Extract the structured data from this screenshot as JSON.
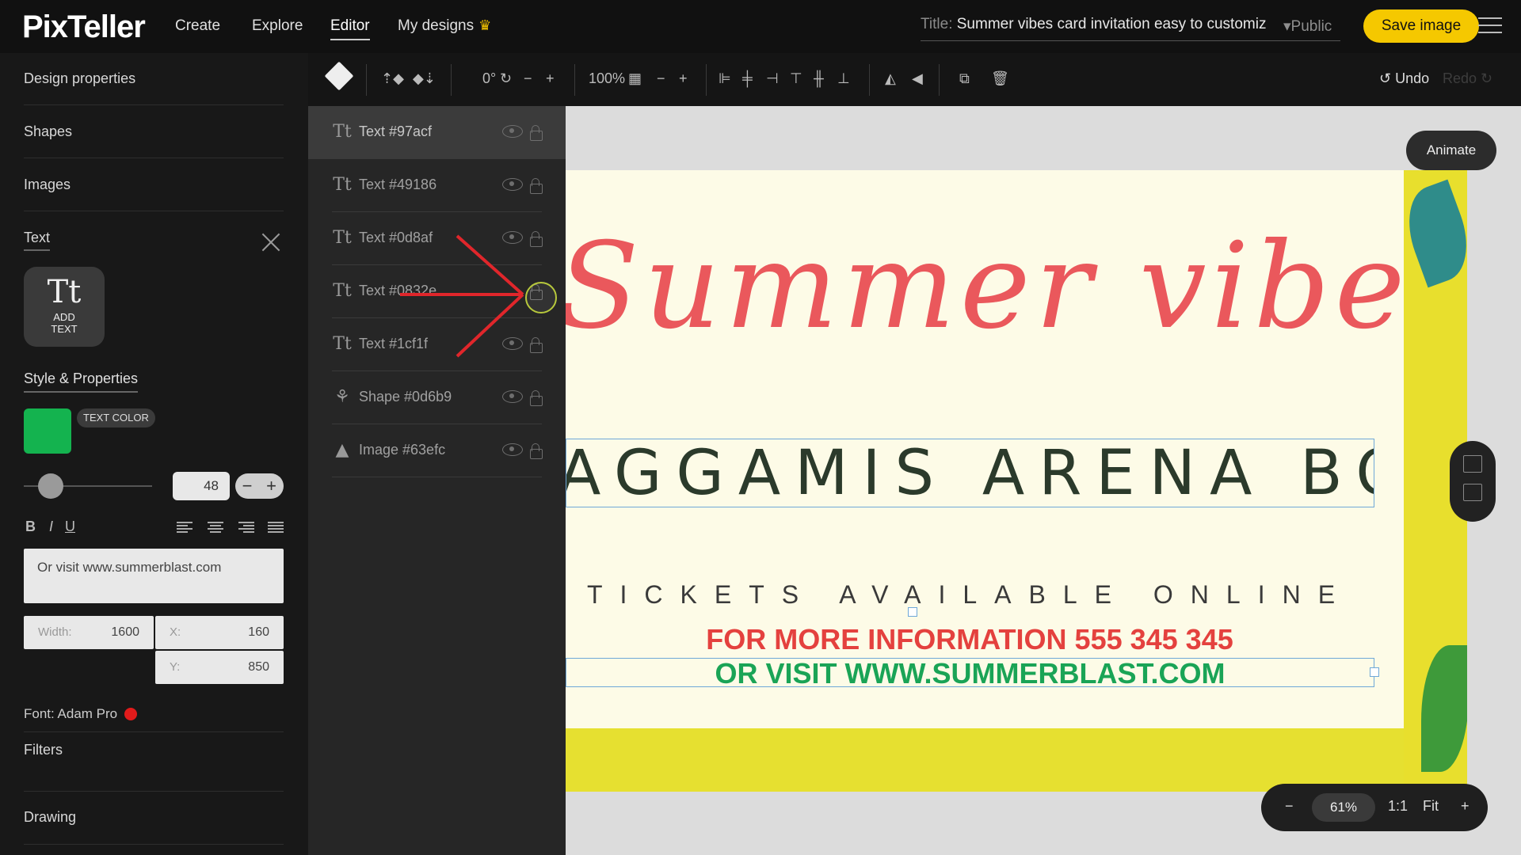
{
  "app": {
    "logo": "PixTeller"
  },
  "nav": {
    "create": "Create",
    "explore": "Explore",
    "editor": "Editor",
    "my_designs": "My designs"
  },
  "header": {
    "title_label": "Title:",
    "title_value": "Summer vibes card invitation easy to customiz",
    "visibility": "Public",
    "save_label": "Save image"
  },
  "sidebar": {
    "design_properties": "Design properties",
    "shapes": "Shapes",
    "images": "Images",
    "text": "Text",
    "add_text": "ADD TEXT",
    "style_properties": "Style & Properties",
    "text_color_label": "TEXT COLOR",
    "text_color": "#14b34f",
    "font_size": "48",
    "text_content": "Or visit www.summerblast.com",
    "width_label": "Width:",
    "width_value": "1600",
    "x_label": "X:",
    "x_value": "160",
    "y_label": "Y:",
    "y_value": "850",
    "font_label": "Font:",
    "font_value": "Adam Pro",
    "filters": "Filters",
    "drawing": "Drawing"
  },
  "toolbar": {
    "rotation": "0°",
    "opacity": "100%",
    "undo": "Undo",
    "redo": "Redo"
  },
  "layers": [
    {
      "icon": "text-icon",
      "name": "Text #97acf"
    },
    {
      "icon": "text-icon",
      "name": "Text #49186"
    },
    {
      "icon": "text-icon",
      "name": "Text #0d8af"
    },
    {
      "icon": "text-icon",
      "name": "Text #0832e"
    },
    {
      "icon": "text-icon",
      "name": "Text #1cf1f"
    },
    {
      "icon": "shape-icon",
      "name": "Shape #0d6b9"
    },
    {
      "icon": "image-icon",
      "name": "Image #63efc"
    }
  ],
  "canvas": {
    "animate": "Animate",
    "script_title": "Summer vibes",
    "venue": "AGGAMIS ARENA BOSTON",
    "tickets": "TICKETS AVAILABLE ONLINE",
    "more_info": "FOR MORE INFORMATION 555 345 345",
    "visit": "OR VISIT WWW.SUMMERBLAST.COM"
  },
  "zoom": {
    "value": "61%",
    "one_to_one": "1:1",
    "fit": "Fit"
  }
}
